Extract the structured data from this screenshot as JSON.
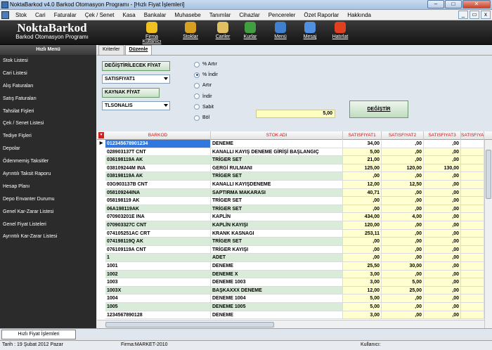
{
  "window": {
    "title": "NoktaBarkod v4.0 Barkod Otomasyon Programı - [Hızlı Fiyat İşlemleri]",
    "min": "–",
    "max": "□",
    "close": "✕"
  },
  "menu": [
    "Stok",
    "Cari",
    "Faturalar",
    "Çek / Senet",
    "Kasa",
    "Bankalar",
    "Muhasebe",
    "Tanımlar",
    "Cihazlar",
    "Pencereler",
    "Özet Raporlar",
    "Hakkında"
  ],
  "mdi": {
    "min": "_",
    "restore": "▭",
    "close": "x"
  },
  "logo": {
    "name": "NoktaBarkod",
    "subtitle": "Barkod Otomasyon Programı"
  },
  "toolbar": [
    {
      "label": "Firma Kullanıcı",
      "color": "#f0c020"
    },
    {
      "label": "Stoklar",
      "color": "#d8a020"
    },
    {
      "label": "Cariler",
      "color": "#e0c060"
    },
    {
      "label": "Kurlar",
      "color": "#40a040"
    },
    {
      "label": "Menü",
      "color": "#4080d0"
    },
    {
      "label": "Mesaj",
      "color": "#5090e0"
    },
    {
      "label": "Hatırlat",
      "color": "#e04020"
    }
  ],
  "sidebar": {
    "header": "Hızlı Menü",
    "items": [
      "Stok Listesi",
      "Cari Listesi",
      "Alış Faturaları",
      "Satış Faturaları",
      "Tahsilat Fişleri",
      "Çek / Senet Listesi",
      "Tediye Fişleri",
      "Depolar",
      "Ödenmemiş Taksitler",
      "Ayrıntılı Taksit Raporu",
      "Hesap Planı",
      "Depo Envanter Durumu",
      "Genel Kar-Zarar Listesi",
      "Genel Fiyat Listeleri",
      "Ayrıntılı Kar-Zarar Listesi"
    ]
  },
  "tabs": [
    "Kriterler",
    "Düzenle"
  ],
  "form": {
    "target_label": "DEĞİŞTİRİLECEK FİYAT",
    "target_value": "SATISFIYAT1",
    "source_label": "KAYNAK FİYAT",
    "source_value": "TLSONALIS",
    "options": [
      "% Artır",
      "% İndir",
      "Artır",
      "İndir",
      "Sabit",
      "Böl"
    ],
    "selected_option": 1,
    "amount": "5,00",
    "apply_button": "DEĞİŞTİR"
  },
  "grid": {
    "columns": [
      "BARKOD",
      "STOK ADI",
      "SATISFIYAT1",
      "SATISFIYAT2",
      "SATISFIYAT3",
      "SATISFIYA"
    ],
    "rows": [
      [
        "012345678901234",
        "DENEME",
        "34,00",
        ",00",
        ",00"
      ],
      [
        "028903137T CNT",
        "KANALLI KAYIŞ DENEME GİRİŞİ BAŞLANGIÇ",
        "5,00",
        ",00",
        ",00"
      ],
      [
        "036198119A AK",
        "TRİGER SET",
        "21,00",
        ",00",
        ",00"
      ],
      [
        "038109244M INA",
        "GERGİ RULMANI",
        "125,00",
        "120,00",
        "130,00"
      ],
      [
        "038198119A AK",
        "TRİGER SET",
        ",00",
        ",00",
        ",00"
      ],
      [
        "03G903137B CNT",
        "KANALLI KAYIŞDENEME",
        "12,00",
        "12,50",
        ",00"
      ],
      [
        "058109244INA",
        "SAPTIRMA MAKARASI",
        "40,71",
        ",00",
        ",00"
      ],
      [
        "058198119 AK",
        "TRİGER SET",
        ",00",
        ",00",
        ",00"
      ],
      [
        "06A198119AK",
        "TRİGER SET",
        ",00",
        ",00",
        ",00"
      ],
      [
        "070903201E INA",
        "KAPLİN",
        "434,00",
        "4,00",
        ",00"
      ],
      [
        "070903327C CNT",
        "KAPLİN KAYIŞI",
        "120,00",
        ",00",
        ",00"
      ],
      [
        "074105251AC CRT",
        "KRANK KASNAGI",
        "253,11",
        ",00",
        ",00"
      ],
      [
        "074198119Q AK",
        "TRİGER SET",
        ",00",
        ",00",
        ",00"
      ],
      [
        "076109119A CNT",
        "TRİGER KAYIŞI",
        ",00",
        ",00",
        ",00"
      ],
      [
        "1",
        "ADET",
        ",00",
        ",00",
        ",00"
      ],
      [
        "1001",
        "DENEME",
        "25,50",
        "30,00",
        ",00"
      ],
      [
        "1002",
        "DENEME X",
        "3,00",
        ",00",
        ",00"
      ],
      [
        "1003",
        "DENEME 1003",
        "3,00",
        "5,00",
        ",00"
      ],
      [
        "1003X",
        "BAŞKAXXX DENEME",
        "12,00",
        "25,00",
        ",00"
      ],
      [
        "1004",
        "DENEME 1004",
        "5,00",
        ",00",
        ",00"
      ],
      [
        "1005",
        "DENEME 1005",
        "5,00",
        ",00",
        ",00"
      ],
      [
        "1234567890128",
        "DENEME",
        "3,00",
        ",00",
        ",00"
      ]
    ]
  },
  "bottom_tab": "Hızlı Fiyat İşlemleri",
  "status": {
    "date": "Tarih : 19 Şubat 2012 Pazar",
    "firm": "Firma:MARKET-2010",
    "user": "Kullanıcı:"
  }
}
